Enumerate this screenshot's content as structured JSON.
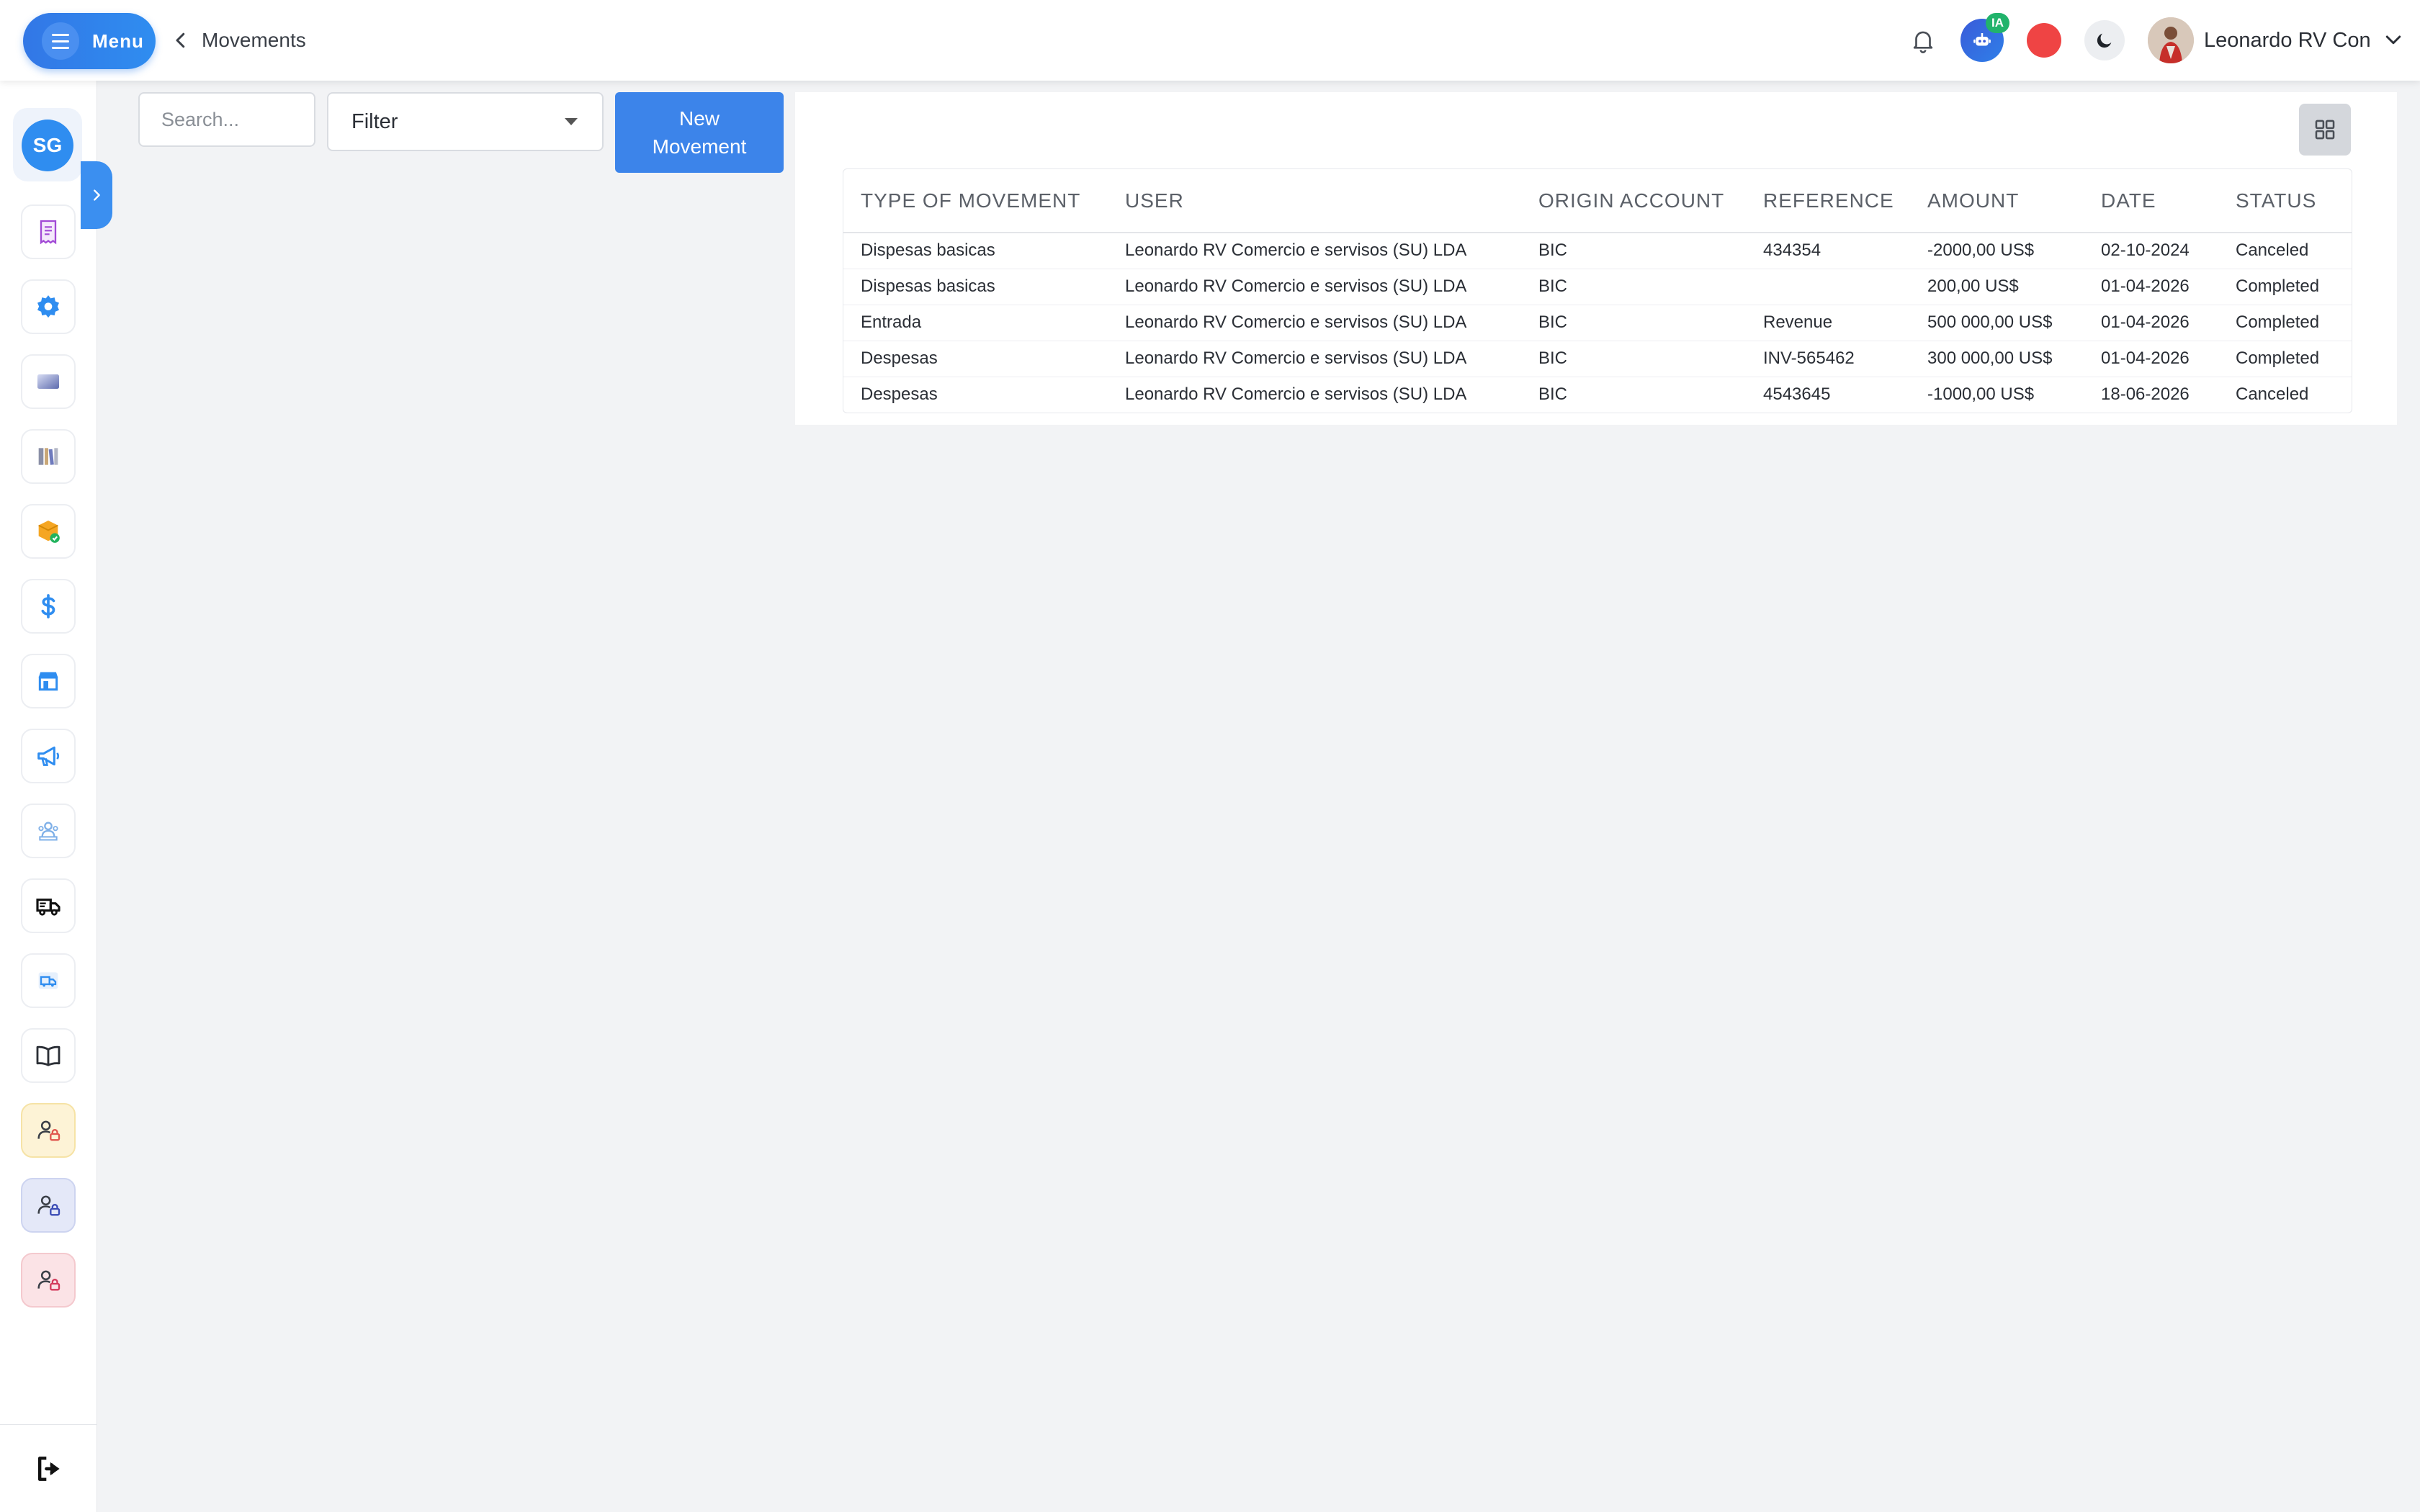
{
  "header": {
    "menu_label": "Menu",
    "back_label": "Movements",
    "assistant_badge": "IA",
    "user_name": "Leonardo RV Con"
  },
  "sidebar": {
    "brand_initials": "SG",
    "items": [
      {
        "icon": "receipt-icon"
      },
      {
        "icon": "gear-icon"
      },
      {
        "icon": "card-icon"
      },
      {
        "icon": "books-icon"
      },
      {
        "icon": "box-check-icon"
      },
      {
        "icon": "dollar-icon"
      },
      {
        "icon": "store-icon"
      },
      {
        "icon": "megaphone-icon"
      },
      {
        "icon": "team-icon"
      },
      {
        "icon": "truck-icon"
      },
      {
        "icon": "delivery-icon"
      },
      {
        "icon": "book-open-icon"
      },
      {
        "icon": "user-lock-icon"
      },
      {
        "icon": "user-lock-icon"
      },
      {
        "icon": "user-lock-icon"
      }
    ],
    "logout_icon": "logout-icon"
  },
  "controls": {
    "search_placeholder": "Search...",
    "filter_label": "Filter",
    "new_button_label": "New Movement"
  },
  "table": {
    "columns": [
      "TYPE OF MOVEMENT",
      "USER",
      "ORIGIN ACCOUNT",
      "REFERENCE",
      "AMOUNT",
      "DATE",
      "STATUS"
    ],
    "rows": [
      [
        "Dispesas basicas",
        "Leonardo RV Comercio e servisos (SU) LDA",
        "BIC",
        "434354",
        "-2000,00 US$",
        "02-10-2024",
        "Canceled"
      ],
      [
        "Dispesas basicas",
        "Leonardo RV Comercio e servisos (SU) LDA",
        "BIC",
        "",
        "200,00 US$",
        "01-04-2026",
        "Completed"
      ],
      [
        "Entrada",
        "Leonardo RV Comercio e servisos (SU) LDA",
        "BIC",
        "Revenue",
        "500 000,00 US$",
        "01-04-2026",
        "Completed"
      ],
      [
        "Despesas",
        "Leonardo RV Comercio e servisos (SU) LDA",
        "BIC",
        "INV-565462",
        "300 000,00 US$",
        "01-04-2026",
        "Completed"
      ],
      [
        "Despesas",
        "Leonardo RV Comercio e servisos (SU) LDA",
        "BIC",
        "4543645",
        "-1000,00 US$",
        "18-06-2026",
        "Canceled"
      ]
    ]
  },
  "colors": {
    "primary": "#3c84ea",
    "record": "#ef4444",
    "badge": "#21b36b"
  }
}
